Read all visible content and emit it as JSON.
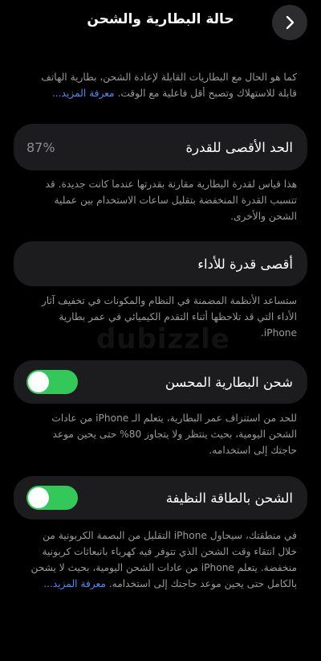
{
  "header": {
    "title": "حالة البطارية والشحن",
    "back_icon": "chevron-right-icon"
  },
  "intro": {
    "text": "كما هو الحال مع البطاريات القابلة لإعادة الشحن، بطارية الهاتف قابلة للاستهلاك وتصبح أقل فاعلية مع الوقت.",
    "link": "معرفة المزيد..."
  },
  "max_capacity": {
    "label": "الحد الأقصى للقدرة",
    "value": "87%",
    "note": "هذا قياس لقدرة البطارية مقارنة بقدرتها عندما كانت جديدة. قد تتسبب القدرة المنخفضة بتقليل ساعات الاستخدام بين عملية الشحن والأخرى."
  },
  "peak_performance": {
    "label": "أقصى قدرة للأداء",
    "note": "ستساعد الأنظمة المضمنة في النظام والمكونات في تخفيف آثار الأداء التي قد تلاحظها أثناء التقدم الكيميائي في عمر بطارية iPhone."
  },
  "optimized_charging": {
    "label": "شحن البطارية المحسن",
    "enabled": true,
    "note": "للحد من استنزاف عمر البطارية، يتعلم الـ iPhone من عادات الشحن اليومية، بحيث ينتظر ولا يتجاوز 80% حتى يحين موعد حاجتك إلى استخدامه."
  },
  "clean_energy": {
    "label": "الشحن بالطاقة النظيفة",
    "enabled": true,
    "note": "في منطقتك، سيحاول iPhone التقليل من البصمة الكربونية من خلال انتقاء وقت الشحن الذي تتوفر فيه كهرباء بانبعاثات كربونية منخفضة. يتعلم iPhone من عادات الشحن اليومية، بحيث لا يشحن بالكامل حتى يحين موعد حاجتك إلى استخدامه.",
    "link": "معرفة المزيد..."
  },
  "watermark": "dubizzle",
  "colors": {
    "background": "#000000",
    "card": "#1c1c1e",
    "toggle_on": "#34c759",
    "link": "#4c8cf5",
    "secondary_text": "#9a9a9e"
  }
}
